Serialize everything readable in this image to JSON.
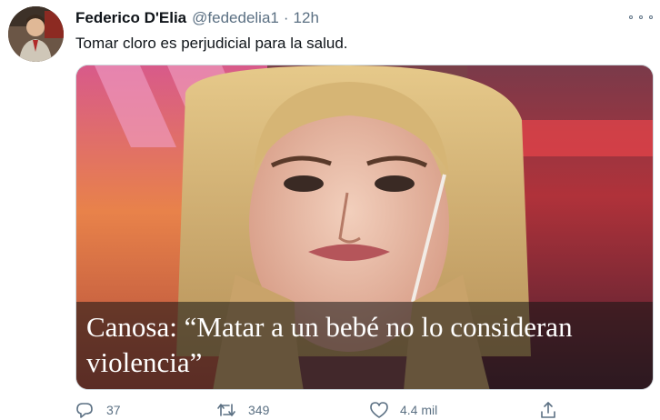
{
  "tweet": {
    "author": {
      "display_name": "Federico D'Elia",
      "handle": "@fededelia1",
      "avatar_icon": "avatar-photo"
    },
    "separator": "·",
    "timestamp": "12h",
    "text": "Tomar cloro es perjudicial para la salud.",
    "media": {
      "caption_line1": "Canosa: “Matar a un bebé no lo consideran",
      "caption_line2": "violencia”"
    },
    "stats": {
      "replies": "37",
      "retweets": "349",
      "likes": "4.4 mil"
    },
    "icons": {
      "reply": "reply-icon",
      "retweet": "retweet-icon",
      "like": "heart-icon",
      "share": "share-icon",
      "more": "more-icon"
    },
    "colors": {
      "text": "#0f1419",
      "secondary": "#5b7083"
    }
  }
}
